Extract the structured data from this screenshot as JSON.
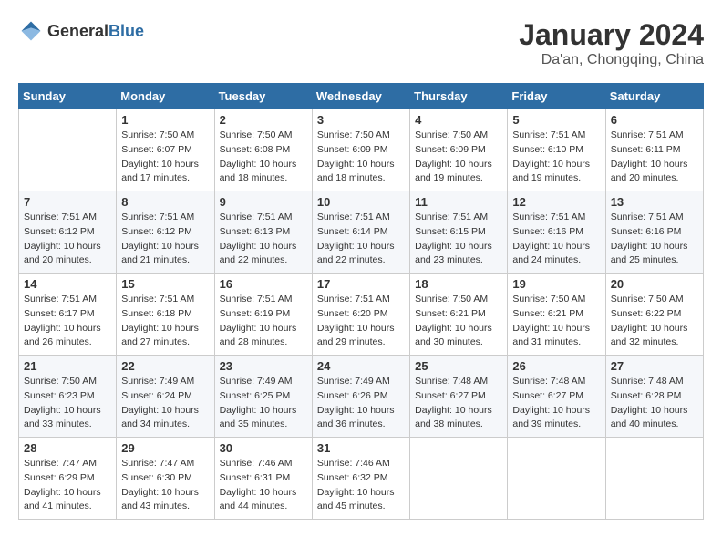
{
  "header": {
    "logo_general": "General",
    "logo_blue": "Blue",
    "month_year": "January 2024",
    "location": "Da'an, Chongqing, China"
  },
  "days_of_week": [
    "Sunday",
    "Monday",
    "Tuesday",
    "Wednesday",
    "Thursday",
    "Friday",
    "Saturday"
  ],
  "weeks": [
    [
      {
        "day": "",
        "sunrise": "",
        "sunset": "",
        "daylight": ""
      },
      {
        "day": "1",
        "sunrise": "Sunrise: 7:50 AM",
        "sunset": "Sunset: 6:07 PM",
        "daylight": "Daylight: 10 hours and 17 minutes."
      },
      {
        "day": "2",
        "sunrise": "Sunrise: 7:50 AM",
        "sunset": "Sunset: 6:08 PM",
        "daylight": "Daylight: 10 hours and 18 minutes."
      },
      {
        "day": "3",
        "sunrise": "Sunrise: 7:50 AM",
        "sunset": "Sunset: 6:09 PM",
        "daylight": "Daylight: 10 hours and 18 minutes."
      },
      {
        "day": "4",
        "sunrise": "Sunrise: 7:50 AM",
        "sunset": "Sunset: 6:09 PM",
        "daylight": "Daylight: 10 hours and 19 minutes."
      },
      {
        "day": "5",
        "sunrise": "Sunrise: 7:51 AM",
        "sunset": "Sunset: 6:10 PM",
        "daylight": "Daylight: 10 hours and 19 minutes."
      },
      {
        "day": "6",
        "sunrise": "Sunrise: 7:51 AM",
        "sunset": "Sunset: 6:11 PM",
        "daylight": "Daylight: 10 hours and 20 minutes."
      }
    ],
    [
      {
        "day": "7",
        "sunrise": "Sunrise: 7:51 AM",
        "sunset": "Sunset: 6:12 PM",
        "daylight": "Daylight: 10 hours and 20 minutes."
      },
      {
        "day": "8",
        "sunrise": "Sunrise: 7:51 AM",
        "sunset": "Sunset: 6:12 PM",
        "daylight": "Daylight: 10 hours and 21 minutes."
      },
      {
        "day": "9",
        "sunrise": "Sunrise: 7:51 AM",
        "sunset": "Sunset: 6:13 PM",
        "daylight": "Daylight: 10 hours and 22 minutes."
      },
      {
        "day": "10",
        "sunrise": "Sunrise: 7:51 AM",
        "sunset": "Sunset: 6:14 PM",
        "daylight": "Daylight: 10 hours and 22 minutes."
      },
      {
        "day": "11",
        "sunrise": "Sunrise: 7:51 AM",
        "sunset": "Sunset: 6:15 PM",
        "daylight": "Daylight: 10 hours and 23 minutes."
      },
      {
        "day": "12",
        "sunrise": "Sunrise: 7:51 AM",
        "sunset": "Sunset: 6:16 PM",
        "daylight": "Daylight: 10 hours and 24 minutes."
      },
      {
        "day": "13",
        "sunrise": "Sunrise: 7:51 AM",
        "sunset": "Sunset: 6:16 PM",
        "daylight": "Daylight: 10 hours and 25 minutes."
      }
    ],
    [
      {
        "day": "14",
        "sunrise": "Sunrise: 7:51 AM",
        "sunset": "Sunset: 6:17 PM",
        "daylight": "Daylight: 10 hours and 26 minutes."
      },
      {
        "day": "15",
        "sunrise": "Sunrise: 7:51 AM",
        "sunset": "Sunset: 6:18 PM",
        "daylight": "Daylight: 10 hours and 27 minutes."
      },
      {
        "day": "16",
        "sunrise": "Sunrise: 7:51 AM",
        "sunset": "Sunset: 6:19 PM",
        "daylight": "Daylight: 10 hours and 28 minutes."
      },
      {
        "day": "17",
        "sunrise": "Sunrise: 7:51 AM",
        "sunset": "Sunset: 6:20 PM",
        "daylight": "Daylight: 10 hours and 29 minutes."
      },
      {
        "day": "18",
        "sunrise": "Sunrise: 7:50 AM",
        "sunset": "Sunset: 6:21 PM",
        "daylight": "Daylight: 10 hours and 30 minutes."
      },
      {
        "day": "19",
        "sunrise": "Sunrise: 7:50 AM",
        "sunset": "Sunset: 6:21 PM",
        "daylight": "Daylight: 10 hours and 31 minutes."
      },
      {
        "day": "20",
        "sunrise": "Sunrise: 7:50 AM",
        "sunset": "Sunset: 6:22 PM",
        "daylight": "Daylight: 10 hours and 32 minutes."
      }
    ],
    [
      {
        "day": "21",
        "sunrise": "Sunrise: 7:50 AM",
        "sunset": "Sunset: 6:23 PM",
        "daylight": "Daylight: 10 hours and 33 minutes."
      },
      {
        "day": "22",
        "sunrise": "Sunrise: 7:49 AM",
        "sunset": "Sunset: 6:24 PM",
        "daylight": "Daylight: 10 hours and 34 minutes."
      },
      {
        "day": "23",
        "sunrise": "Sunrise: 7:49 AM",
        "sunset": "Sunset: 6:25 PM",
        "daylight": "Daylight: 10 hours and 35 minutes."
      },
      {
        "day": "24",
        "sunrise": "Sunrise: 7:49 AM",
        "sunset": "Sunset: 6:26 PM",
        "daylight": "Daylight: 10 hours and 36 minutes."
      },
      {
        "day": "25",
        "sunrise": "Sunrise: 7:48 AM",
        "sunset": "Sunset: 6:27 PM",
        "daylight": "Daylight: 10 hours and 38 minutes."
      },
      {
        "day": "26",
        "sunrise": "Sunrise: 7:48 AM",
        "sunset": "Sunset: 6:27 PM",
        "daylight": "Daylight: 10 hours and 39 minutes."
      },
      {
        "day": "27",
        "sunrise": "Sunrise: 7:48 AM",
        "sunset": "Sunset: 6:28 PM",
        "daylight": "Daylight: 10 hours and 40 minutes."
      }
    ],
    [
      {
        "day": "28",
        "sunrise": "Sunrise: 7:47 AM",
        "sunset": "Sunset: 6:29 PM",
        "daylight": "Daylight: 10 hours and 41 minutes."
      },
      {
        "day": "29",
        "sunrise": "Sunrise: 7:47 AM",
        "sunset": "Sunset: 6:30 PM",
        "daylight": "Daylight: 10 hours and 43 minutes."
      },
      {
        "day": "30",
        "sunrise": "Sunrise: 7:46 AM",
        "sunset": "Sunset: 6:31 PM",
        "daylight": "Daylight: 10 hours and 44 minutes."
      },
      {
        "day": "31",
        "sunrise": "Sunrise: 7:46 AM",
        "sunset": "Sunset: 6:32 PM",
        "daylight": "Daylight: 10 hours and 45 minutes."
      },
      {
        "day": "",
        "sunrise": "",
        "sunset": "",
        "daylight": ""
      },
      {
        "day": "",
        "sunrise": "",
        "sunset": "",
        "daylight": ""
      },
      {
        "day": "",
        "sunrise": "",
        "sunset": "",
        "daylight": ""
      }
    ]
  ]
}
